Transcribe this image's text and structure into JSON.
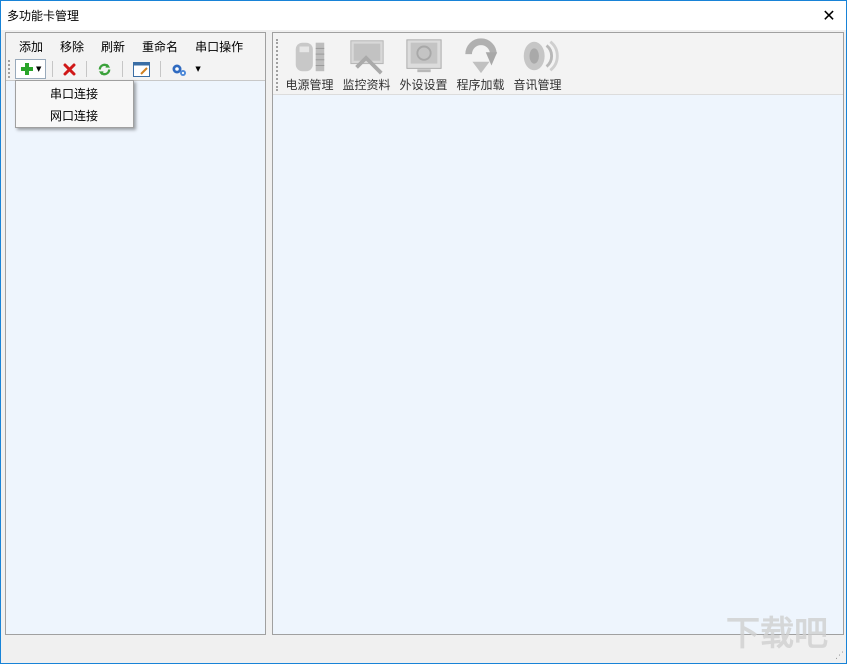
{
  "window": {
    "title": "多功能卡管理",
    "close_glyph": "✕"
  },
  "left": {
    "menu": [
      "添加",
      "移除",
      "刷新",
      "重命名",
      "串口操作"
    ],
    "toolbar": [
      {
        "icon": "add-icon"
      },
      {
        "icon": "delete-icon"
      },
      {
        "icon": "refresh-icon"
      },
      {
        "icon": "window-icon"
      },
      {
        "icon": "settings-icon"
      }
    ],
    "dropdown": [
      "串口连接",
      "网口连接"
    ]
  },
  "right": {
    "ribbon": [
      {
        "label": "电源管理",
        "icon": "power-icon"
      },
      {
        "label": "监控资料",
        "icon": "monitor-icon"
      },
      {
        "label": "外设设置",
        "icon": "peripheral-icon"
      },
      {
        "label": "程序加载",
        "icon": "load-icon"
      },
      {
        "label": "音讯管理",
        "icon": "speaker-icon"
      }
    ]
  },
  "watermark": "下载吧",
  "colors": {
    "panel_bg": "#eef5fd",
    "accent": "#1883d7"
  }
}
